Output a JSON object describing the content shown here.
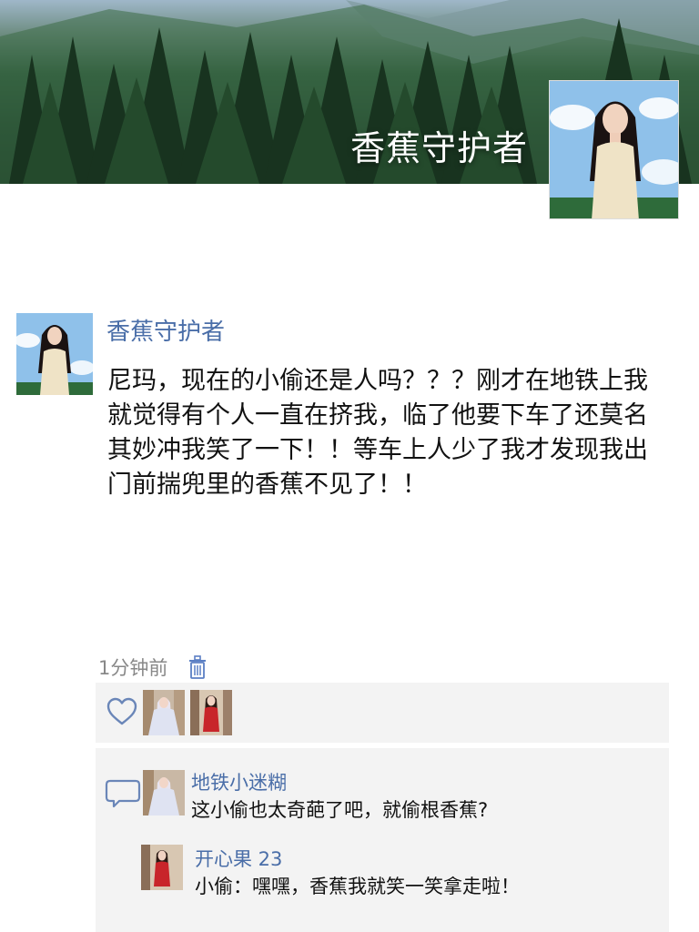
{
  "cover": {
    "title": "香蕉守护者"
  },
  "post": {
    "author": "香蕉守护者",
    "content": "尼玛，现在的小偷还是人吗？？？刚才在地铁上我就觉得有个人一直在挤我，临了他要下车了还莫名其妙冲我笑了一下！！等车上人少了我才发现我出门前揣兜里的香蕉不见了！！",
    "time": "1分钟前"
  },
  "likes": {
    "icon": "heart-icon",
    "count_shown": 2
  },
  "comments": [
    {
      "author": "地铁小迷糊",
      "text": "这小偷也太奇葩了吧，就偷根香蕉?"
    },
    {
      "author": "开心果 23",
      "text": "小偷：嘿嘿，香蕉我就笑一笑拿走啦！"
    }
  ],
  "colors": {
    "link_blue": "#4a6ea8",
    "meta_gray": "#888888",
    "panel_bg": "#f3f3f3"
  }
}
